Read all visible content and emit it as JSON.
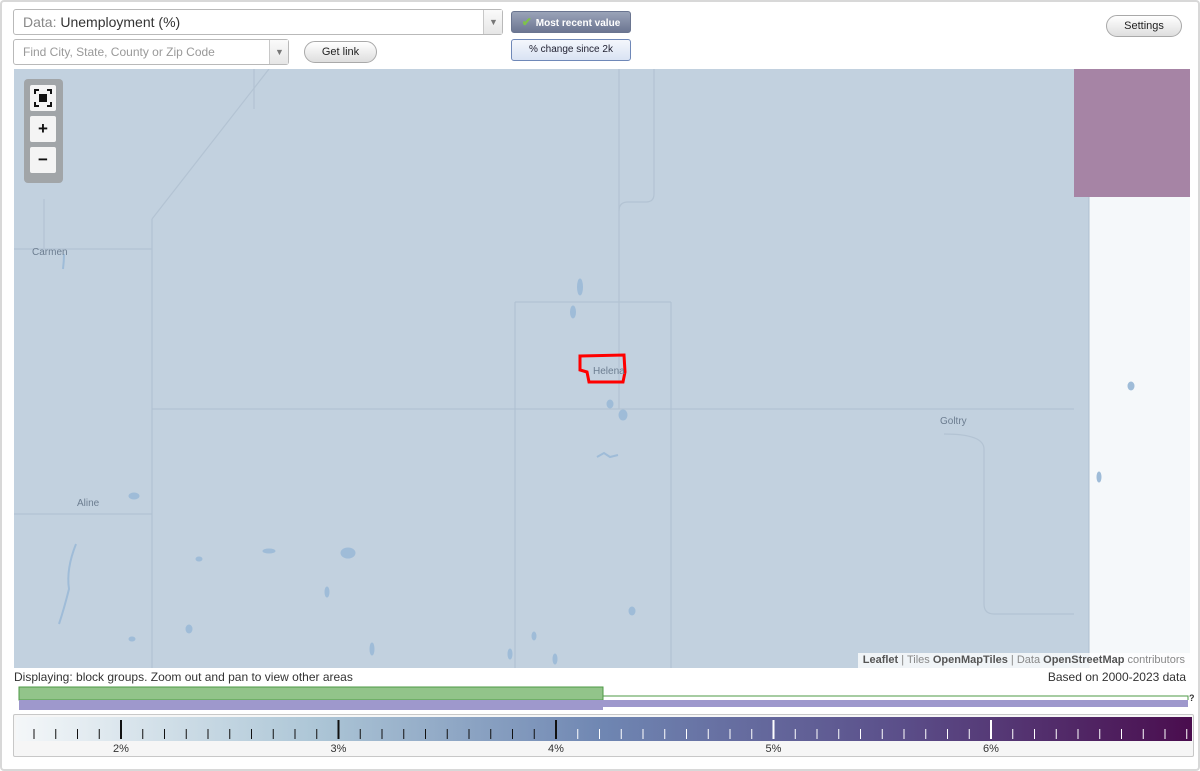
{
  "header": {
    "data_prefix": "Data:",
    "data_value": "Unemployment (%)",
    "search_placeholder": "Find City, State, County or Zip Code",
    "get_link_label": "Get link",
    "mode_recent_label": "Most recent value",
    "mode_change_label": "% change since 2k",
    "settings_label": "Settings"
  },
  "map": {
    "places": [
      "Carmen",
      "Helena",
      "Goltry",
      "Aline"
    ],
    "highlighted_place": "Helena",
    "attribution": {
      "leaflet": "Leaflet",
      "tiles_prefix": "Tiles",
      "tiles": "OpenMapTiles",
      "data_prefix": "Data",
      "data": "OpenStreetMap",
      "suffix": "contributors"
    },
    "colors": {
      "base_fill": "#c2d1df",
      "high_value_fill": "#a684a5",
      "outside_fill": "#f5f8fa",
      "highlight_outline": "#ff0000"
    },
    "zoom_controls": [
      "fullscreen",
      "zoom-in",
      "zoom-out"
    ]
  },
  "footer": {
    "display_text": "Displaying: block groups. Zoom out and pan to view other areas",
    "years_text": "Based on 2000-2023 data",
    "histogram_marker": "?",
    "legend_labels": [
      "2%",
      "3%",
      "4%",
      "5%",
      "6%"
    ],
    "legend_colors": [
      "#f4f7f9",
      "#aec7d7",
      "#6f86b2",
      "#5b4f8a",
      "#4a0d4e"
    ]
  }
}
